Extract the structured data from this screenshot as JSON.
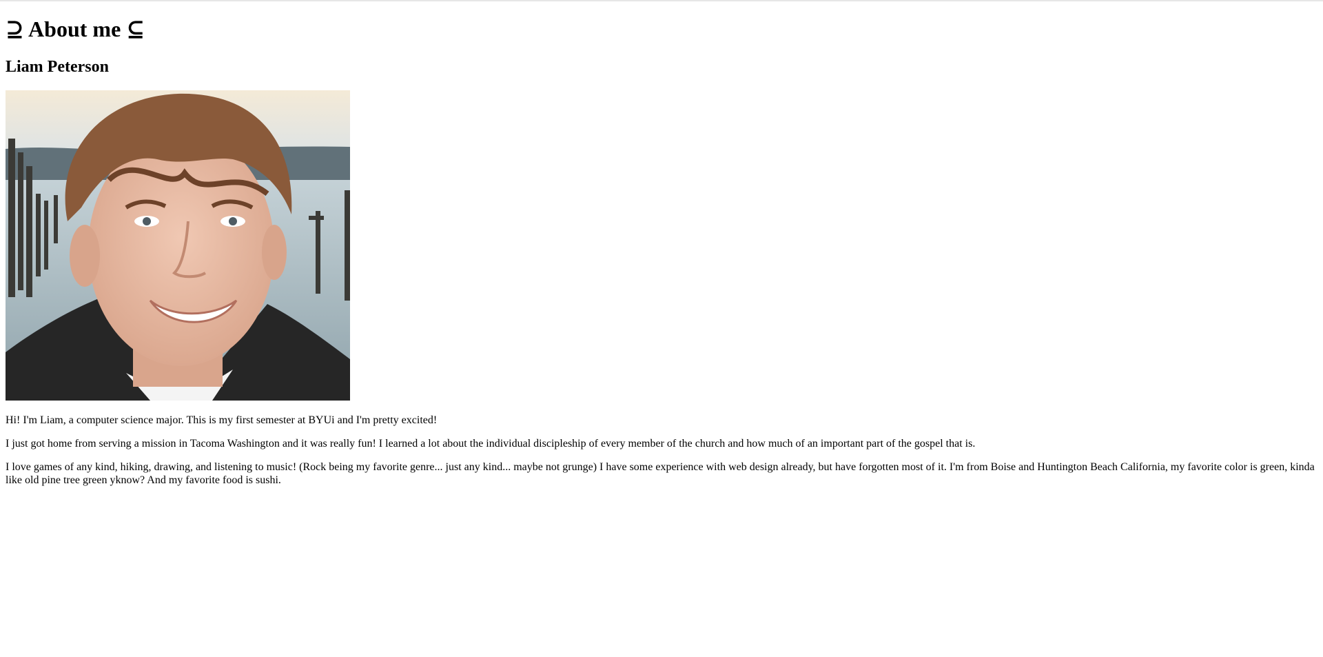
{
  "page": {
    "title": "⊇ About me ⊆",
    "name": "Liam Peterson"
  },
  "photo": {
    "subject": "portrait-photo",
    "colors": {
      "sky_top": "#f3e9d6",
      "sky_bottom": "#dfe4e6",
      "hills": "#5f6f78",
      "water": "#b8c6cc",
      "water_dark": "#8fa1a9",
      "skin": "#e5b9a3",
      "hair": "#8a5a3a",
      "jacket": "#262626",
      "shirt": "#f4f4f4"
    }
  },
  "bio": {
    "paragraphs": [
      "Hi! I'm Liam, a computer science major. This is my first semester at BYUi and I'm pretty excited!",
      "I just got home from serving a mission in Tacoma Washington and it was really fun! I learned a lot about the individual discipleship of every member of the church and how much of an important part of the gospel that is.",
      "I love games of any kind, hiking, drawing, and listening to music! (Rock being my favorite genre... just any kind... maybe not grunge) I have some experience with web design already, but have forgotten most of it. I'm from Boise and Huntington Beach California, my favorite color is green, kinda like old pine tree green yknow? And my favorite food is sushi."
    ]
  }
}
